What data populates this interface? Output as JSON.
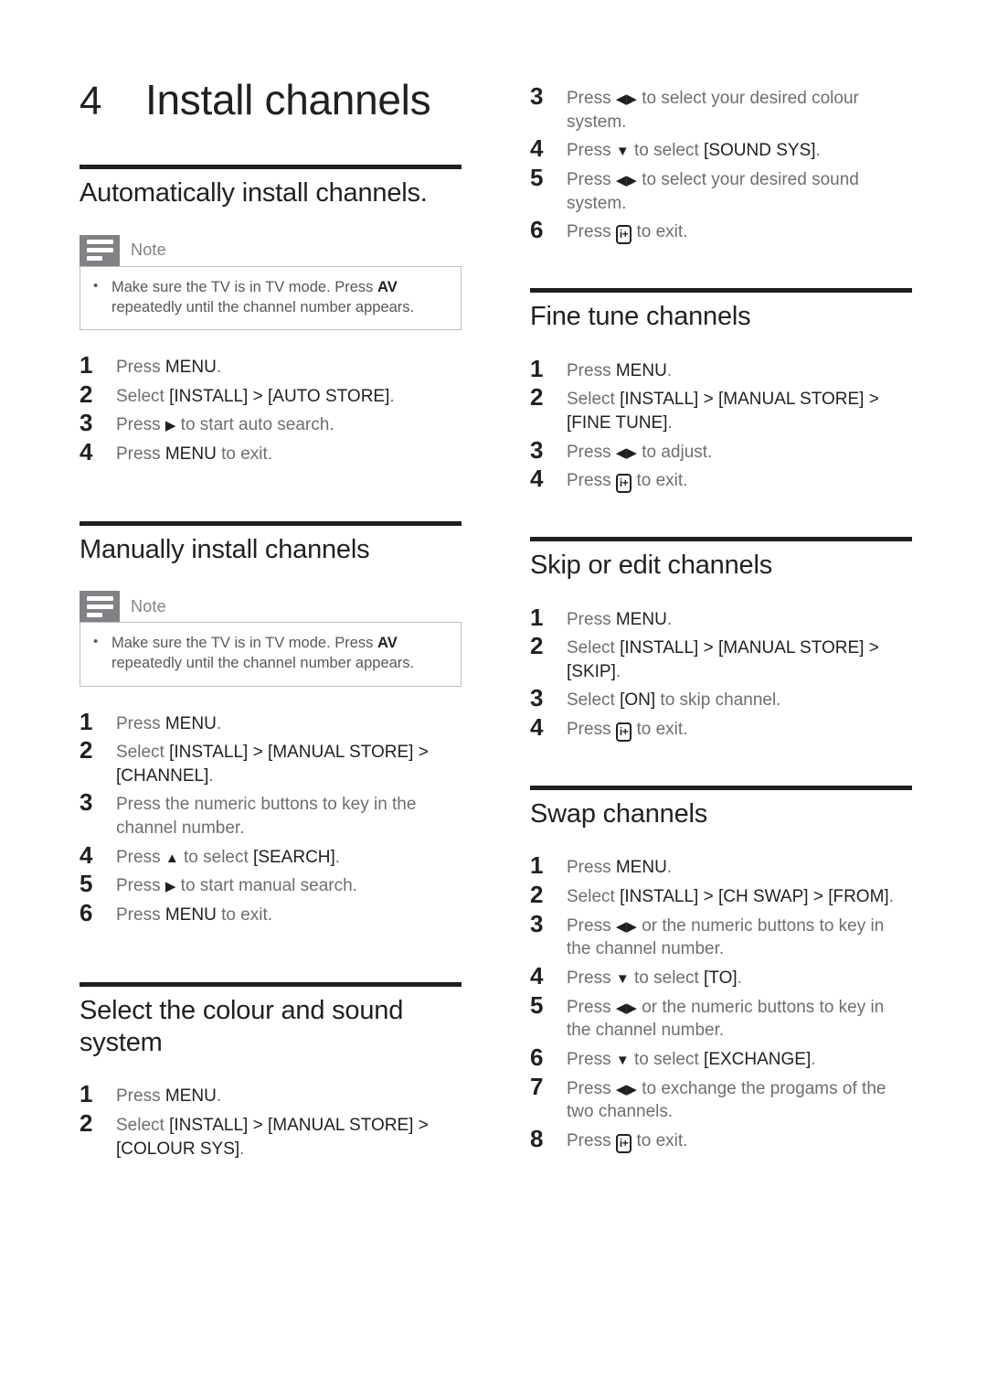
{
  "chapter": {
    "number": "4",
    "title": "Install channels"
  },
  "note_label": "Note",
  "note_text_prefix": "Make sure the TV is in TV mode. Press ",
  "note_text_key": "AV",
  "note_text_suffix": " repeatedly until the channel number appears.",
  "icons": {
    "note": "note-lines-icon",
    "right_arrow": "right-arrow-icon",
    "left_right_arrow": "left-right-arrow-icon",
    "up_arrow": "up-arrow-icon",
    "down_arrow": "down-arrow-icon",
    "info_key": "info-plus-key-icon"
  },
  "colors": {
    "rule": "#231f20",
    "note_icon_bg": "#808285",
    "note_border": "#bcbec0",
    "body_text": "#6d6e71",
    "heading": "#231f20"
  },
  "left_column": {
    "sections": [
      {
        "id": "automatically-install-channels",
        "title": "Automatically install channels.",
        "has_note": true,
        "steps": [
          {
            "n": "1",
            "text": "Press MENU."
          },
          {
            "n": "2",
            "text": "Select [INSTALL] > [AUTO STORE]."
          },
          {
            "n": "3",
            "text": "Press ▶ to start auto search."
          },
          {
            "n": "4",
            "text": "Press MENU to exit."
          }
        ]
      },
      {
        "id": "manually-install-channels",
        "title": "Manually install channels",
        "has_note": true,
        "steps": [
          {
            "n": "1",
            "text": "Press MENU."
          },
          {
            "n": "2",
            "text": "Select [INSTALL] > [MANUAL STORE] > [CHANNEL]."
          },
          {
            "n": "3",
            "text": "Press the numeric buttons to key in the channel number."
          },
          {
            "n": "4",
            "text": "Press ▲ to select [SEARCH]."
          },
          {
            "n": "5",
            "text": "Press ▶ to start manual search."
          },
          {
            "n": "6",
            "text": "Press MENU to exit."
          }
        ]
      },
      {
        "id": "select-colour-and-sound-system",
        "title": "Select the colour and sound system",
        "has_note": false,
        "steps": [
          {
            "n": "1",
            "text": "Press MENU."
          },
          {
            "n": "2",
            "text": "Select [INSTALL] > [MANUAL STORE] > [COLOUR SYS]."
          }
        ]
      }
    ]
  },
  "right_column": {
    "continued_steps": [
      {
        "n": "3",
        "text": "Press ◀▶ to select your desired colour system."
      },
      {
        "n": "4",
        "text": "Press ▼ to select [SOUND SYS]."
      },
      {
        "n": "5",
        "text": "Press ◀▶ to select your desired sound system."
      },
      {
        "n": "6",
        "text": "Press [i+] to exit."
      }
    ],
    "sections": [
      {
        "id": "fine-tune-channels",
        "title": "Fine tune channels",
        "steps": [
          {
            "n": "1",
            "text": "Press MENU."
          },
          {
            "n": "2",
            "text": "Select [INSTALL] > [MANUAL STORE] > [FINE TUNE]."
          },
          {
            "n": "3",
            "text": "Press ◀▶ to adjust."
          },
          {
            "n": "4",
            "text": "Press [i+] to exit."
          }
        ]
      },
      {
        "id": "skip-or-edit-channels",
        "title": "Skip or edit channels",
        "steps": [
          {
            "n": "1",
            "text": "Press MENU."
          },
          {
            "n": "2",
            "text": "Select [INSTALL] > [MANUAL STORE] > [SKIP]."
          },
          {
            "n": "3",
            "text": "Select [ON] to skip channel."
          },
          {
            "n": "4",
            "text": "Press [i+] to exit."
          }
        ]
      },
      {
        "id": "swap-channels",
        "title": "Swap channels",
        "steps": [
          {
            "n": "1",
            "text": "Press MENU."
          },
          {
            "n": "2",
            "text": "Select [INSTALL] > [CH SWAP] > [FROM]."
          },
          {
            "n": "3",
            "text": "Press ◀▶ or the numeric buttons to key in the channel number."
          },
          {
            "n": "4",
            "text": "Press ▼ to select [TO]."
          },
          {
            "n": "5",
            "text": "Press ◀▶ or the numeric buttons to key in the channel number."
          },
          {
            "n": "6",
            "text": "Press ▼ to select [EXCHANGE]."
          },
          {
            "n": "7",
            "text": "Press ◀▶ to exchange the progams of the two channels."
          },
          {
            "n": "8",
            "text": "Press [i+] to exit."
          }
        ]
      }
    ]
  }
}
